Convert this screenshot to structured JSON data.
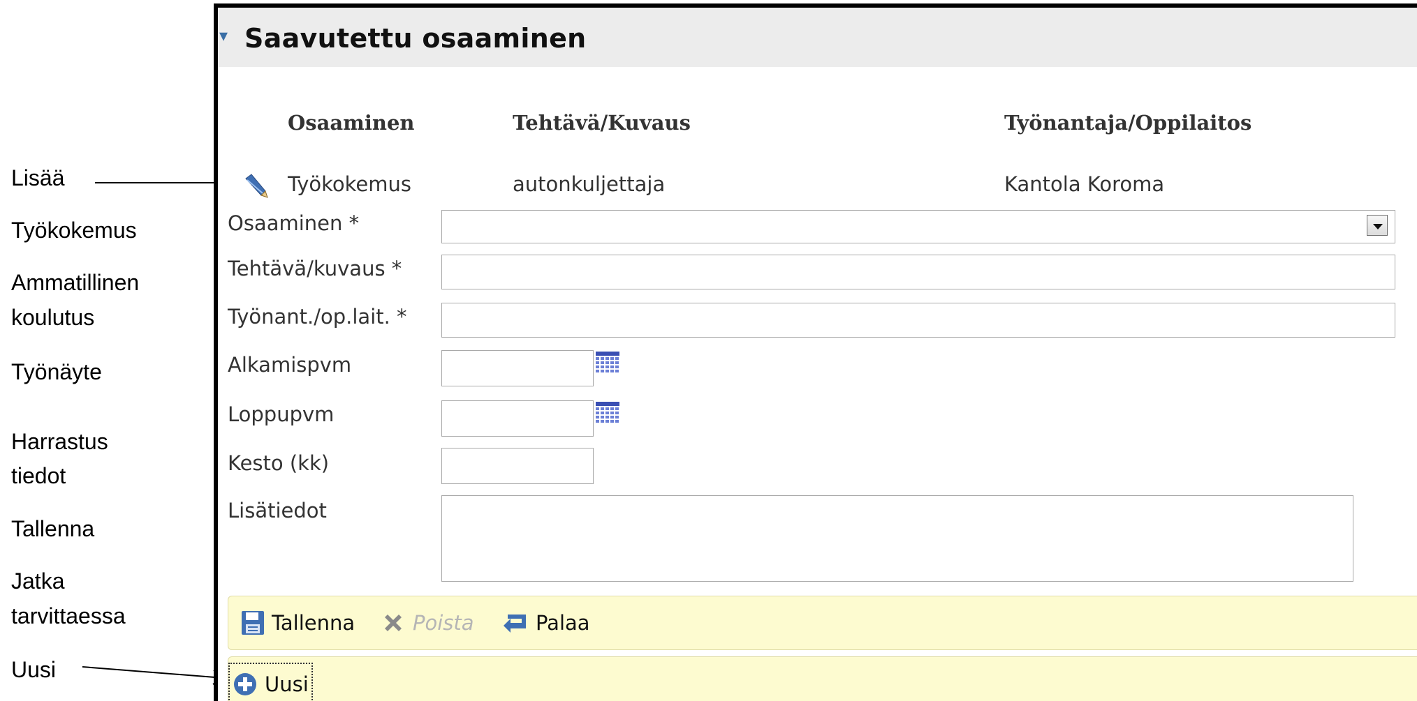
{
  "annotations": {
    "add": "Lisää",
    "work_experience": "Työkokemus",
    "vocational_1": "Ammatillinen",
    "vocational_2": "koulutus",
    "work_sample": "Työnäyte",
    "hobby_1": "Harrastus",
    "hobby_2": "tiedot",
    "save": "Tallenna",
    "continue_1": "Jatka",
    "continue_2": "tarvittaessa",
    "new": "Uusi"
  },
  "panel": {
    "title": "Saavutettu osaaminen",
    "columns": [
      "Osaaminen",
      "Tehtävä/Kuvaus",
      "Työnantaja/Oppilaitos"
    ],
    "row": {
      "skill": "Työkokemus",
      "task": "autonkuljettaja",
      "employer": "Kantola Koroma"
    }
  },
  "form": {
    "skill_label": "Osaaminen *",
    "skill_value": "",
    "task_label": "Tehtävä/kuvaus *",
    "task_value": "",
    "employer_label": "Työnant./op.lait. *",
    "employer_value": "",
    "start_label": "Alkamispvm",
    "start_value": "",
    "end_label": "Loppupvm",
    "end_value": "",
    "duration_label": "Kesto (kk)",
    "duration_value": "",
    "info_label": "Lisätiedot",
    "info_value": ""
  },
  "toolbar": {
    "save": "Tallenna",
    "delete": "Poista",
    "back": "Palaa",
    "new": "Uusi"
  },
  "icons": {
    "edit": "pencil-icon",
    "calendar": "calendar-icon",
    "save": "floppy-disk-icon",
    "delete": "x-icon",
    "back": "return-arrow-icon",
    "new": "plus-circle-icon",
    "dropdown": "chevron-down-icon"
  },
  "colors": {
    "toolbar_bg": "#fdfbd0",
    "header_bg": "#ececec",
    "icon_blue": "#3a6ea5"
  }
}
